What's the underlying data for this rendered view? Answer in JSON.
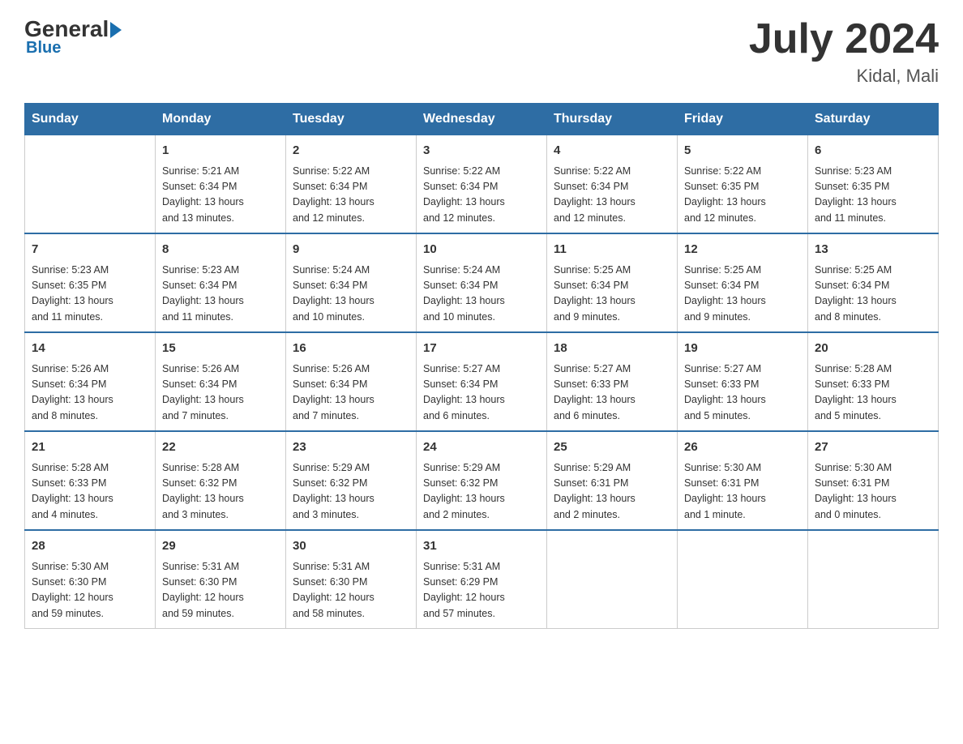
{
  "header": {
    "logo_general": "General",
    "logo_blue": "Blue",
    "month_title": "July 2024",
    "location": "Kidal, Mali"
  },
  "calendar": {
    "days_of_week": [
      "Sunday",
      "Monday",
      "Tuesday",
      "Wednesday",
      "Thursday",
      "Friday",
      "Saturday"
    ],
    "weeks": [
      [
        {
          "day": "",
          "info": ""
        },
        {
          "day": "1",
          "info": "Sunrise: 5:21 AM\nSunset: 6:34 PM\nDaylight: 13 hours\nand 13 minutes."
        },
        {
          "day": "2",
          "info": "Sunrise: 5:22 AM\nSunset: 6:34 PM\nDaylight: 13 hours\nand 12 minutes."
        },
        {
          "day": "3",
          "info": "Sunrise: 5:22 AM\nSunset: 6:34 PM\nDaylight: 13 hours\nand 12 minutes."
        },
        {
          "day": "4",
          "info": "Sunrise: 5:22 AM\nSunset: 6:34 PM\nDaylight: 13 hours\nand 12 minutes."
        },
        {
          "day": "5",
          "info": "Sunrise: 5:22 AM\nSunset: 6:35 PM\nDaylight: 13 hours\nand 12 minutes."
        },
        {
          "day": "6",
          "info": "Sunrise: 5:23 AM\nSunset: 6:35 PM\nDaylight: 13 hours\nand 11 minutes."
        }
      ],
      [
        {
          "day": "7",
          "info": "Sunrise: 5:23 AM\nSunset: 6:35 PM\nDaylight: 13 hours\nand 11 minutes."
        },
        {
          "day": "8",
          "info": "Sunrise: 5:23 AM\nSunset: 6:34 PM\nDaylight: 13 hours\nand 11 minutes."
        },
        {
          "day": "9",
          "info": "Sunrise: 5:24 AM\nSunset: 6:34 PM\nDaylight: 13 hours\nand 10 minutes."
        },
        {
          "day": "10",
          "info": "Sunrise: 5:24 AM\nSunset: 6:34 PM\nDaylight: 13 hours\nand 10 minutes."
        },
        {
          "day": "11",
          "info": "Sunrise: 5:25 AM\nSunset: 6:34 PM\nDaylight: 13 hours\nand 9 minutes."
        },
        {
          "day": "12",
          "info": "Sunrise: 5:25 AM\nSunset: 6:34 PM\nDaylight: 13 hours\nand 9 minutes."
        },
        {
          "day": "13",
          "info": "Sunrise: 5:25 AM\nSunset: 6:34 PM\nDaylight: 13 hours\nand 8 minutes."
        }
      ],
      [
        {
          "day": "14",
          "info": "Sunrise: 5:26 AM\nSunset: 6:34 PM\nDaylight: 13 hours\nand 8 minutes."
        },
        {
          "day": "15",
          "info": "Sunrise: 5:26 AM\nSunset: 6:34 PM\nDaylight: 13 hours\nand 7 minutes."
        },
        {
          "day": "16",
          "info": "Sunrise: 5:26 AM\nSunset: 6:34 PM\nDaylight: 13 hours\nand 7 minutes."
        },
        {
          "day": "17",
          "info": "Sunrise: 5:27 AM\nSunset: 6:34 PM\nDaylight: 13 hours\nand 6 minutes."
        },
        {
          "day": "18",
          "info": "Sunrise: 5:27 AM\nSunset: 6:33 PM\nDaylight: 13 hours\nand 6 minutes."
        },
        {
          "day": "19",
          "info": "Sunrise: 5:27 AM\nSunset: 6:33 PM\nDaylight: 13 hours\nand 5 minutes."
        },
        {
          "day": "20",
          "info": "Sunrise: 5:28 AM\nSunset: 6:33 PM\nDaylight: 13 hours\nand 5 minutes."
        }
      ],
      [
        {
          "day": "21",
          "info": "Sunrise: 5:28 AM\nSunset: 6:33 PM\nDaylight: 13 hours\nand 4 minutes."
        },
        {
          "day": "22",
          "info": "Sunrise: 5:28 AM\nSunset: 6:32 PM\nDaylight: 13 hours\nand 3 minutes."
        },
        {
          "day": "23",
          "info": "Sunrise: 5:29 AM\nSunset: 6:32 PM\nDaylight: 13 hours\nand 3 minutes."
        },
        {
          "day": "24",
          "info": "Sunrise: 5:29 AM\nSunset: 6:32 PM\nDaylight: 13 hours\nand 2 minutes."
        },
        {
          "day": "25",
          "info": "Sunrise: 5:29 AM\nSunset: 6:31 PM\nDaylight: 13 hours\nand 2 minutes."
        },
        {
          "day": "26",
          "info": "Sunrise: 5:30 AM\nSunset: 6:31 PM\nDaylight: 13 hours\nand 1 minute."
        },
        {
          "day": "27",
          "info": "Sunrise: 5:30 AM\nSunset: 6:31 PM\nDaylight: 13 hours\nand 0 minutes."
        }
      ],
      [
        {
          "day": "28",
          "info": "Sunrise: 5:30 AM\nSunset: 6:30 PM\nDaylight: 12 hours\nand 59 minutes."
        },
        {
          "day": "29",
          "info": "Sunrise: 5:31 AM\nSunset: 6:30 PM\nDaylight: 12 hours\nand 59 minutes."
        },
        {
          "day": "30",
          "info": "Sunrise: 5:31 AM\nSunset: 6:30 PM\nDaylight: 12 hours\nand 58 minutes."
        },
        {
          "day": "31",
          "info": "Sunrise: 5:31 AM\nSunset: 6:29 PM\nDaylight: 12 hours\nand 57 minutes."
        },
        {
          "day": "",
          "info": ""
        },
        {
          "day": "",
          "info": ""
        },
        {
          "day": "",
          "info": ""
        }
      ]
    ]
  }
}
